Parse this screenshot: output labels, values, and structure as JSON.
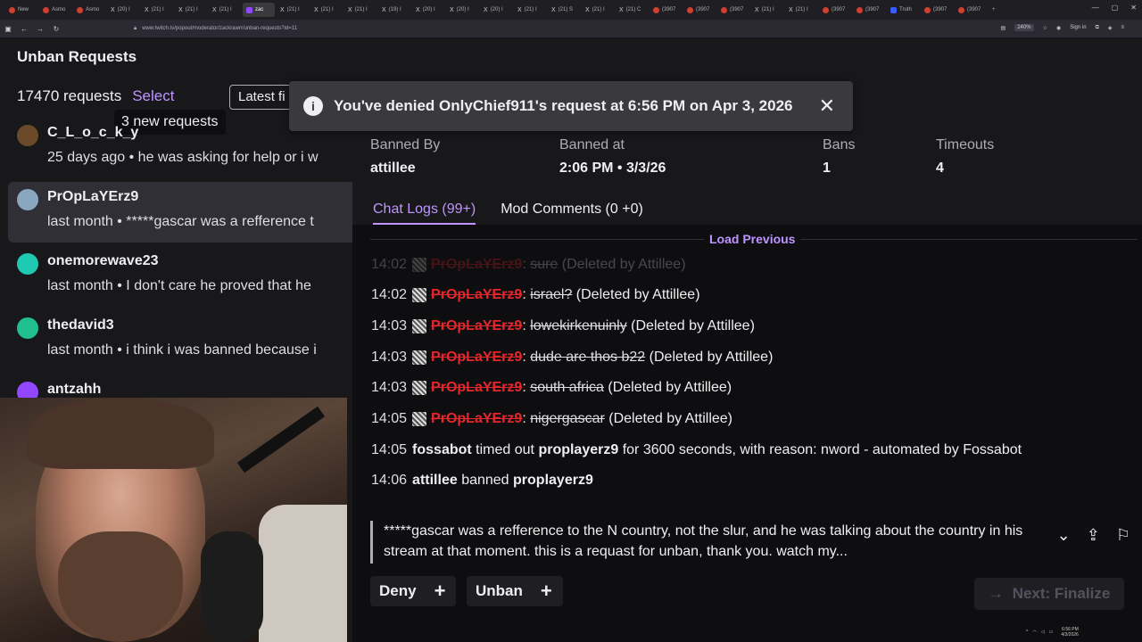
{
  "browser": {
    "tabs": [
      {
        "label": "New",
        "icon": "red"
      },
      {
        "label": "Asmo",
        "icon": "red"
      },
      {
        "label": "Asmo",
        "icon": "red"
      },
      {
        "label": "(20) I",
        "icon": "x"
      },
      {
        "label": "(21) I",
        "icon": "x"
      },
      {
        "label": "(21) I",
        "icon": "x"
      },
      {
        "label": "(21) I",
        "icon": "x"
      },
      {
        "label": "zac",
        "icon": "twitch",
        "active": true
      },
      {
        "label": "(21) I",
        "icon": "x"
      },
      {
        "label": "(21) I",
        "icon": "x"
      },
      {
        "label": "(21) I",
        "icon": "x"
      },
      {
        "label": "(19) I",
        "icon": "x"
      },
      {
        "label": "(20) I",
        "icon": "x"
      },
      {
        "label": "(20) I",
        "icon": "x"
      },
      {
        "label": "(20) I",
        "icon": "x"
      },
      {
        "label": "(21) I",
        "icon": "x"
      },
      {
        "label": "(21) S",
        "icon": "x"
      },
      {
        "label": "(21) I",
        "icon": "x"
      },
      {
        "label": "(21) C",
        "icon": "x"
      },
      {
        "label": "(3907",
        "icon": "red"
      },
      {
        "label": "(3907",
        "icon": "red"
      },
      {
        "label": "(3907",
        "icon": "red"
      },
      {
        "label": "(21) I",
        "icon": "x"
      },
      {
        "label": "(21) I",
        "icon": "x"
      },
      {
        "label": "(3907",
        "icon": "red"
      },
      {
        "label": "(3907",
        "icon": "red"
      },
      {
        "label": "Truth",
        "icon": "truth"
      },
      {
        "label": "(3907",
        "icon": "red"
      },
      {
        "label": "(3907",
        "icon": "red"
      }
    ],
    "url": "www.twitch.tv/popout/moderator/zackrawrr/unban-requests?id=11",
    "zoom": "240%",
    "sign_in": "Sign in"
  },
  "sidebar": {
    "title": "Unban Requests",
    "count": "17470 requests",
    "select": "Select",
    "filter": "Latest fi",
    "new_requests": "3 new requests",
    "requests": [
      {
        "name": "C_L_o_c_k_y",
        "meta": "25 days ago • he was asking for help or i w",
        "avatar_color": "#6b4a2a"
      },
      {
        "name": "PrOpLaYErz9",
        "meta": "last month • *****gascar was a refference t",
        "avatar_color": "#8aa7c0"
      },
      {
        "name": "onemorewave23",
        "meta": "last month • I don't care he proved that he",
        "avatar_color": "#1fc8b0"
      },
      {
        "name": "thedavid3",
        "meta": "last month • i think i was banned because i",
        "avatar_color": "#1fbf8f"
      },
      {
        "name": "antzahh",
        "meta": "",
        "avatar_color": "#9146ff"
      }
    ]
  },
  "toast": {
    "message": "You've denied OnlyChief911's request at 6:56 PM on Apr 3, 2026"
  },
  "details": {
    "banned_by_label": "Banned By",
    "banned_by": "attillee",
    "banned_at_label": "Banned at",
    "banned_at": "2:06 PM • 3/3/26",
    "bans_label": "Bans",
    "bans": "1",
    "timeouts_label": "Timeouts",
    "timeouts": "4"
  },
  "tabs": {
    "chat_logs": "Chat Logs (99+)",
    "mod_comments": "Mod Comments (0 +0)"
  },
  "load_previous": "Load Previous",
  "chat_log": [
    {
      "time": "14:02",
      "user": "PrOpLaYErz9",
      "msg": "sure",
      "note": "(Deleted by Attillee)",
      "faded": true
    },
    {
      "time": "14:02",
      "user": "PrOpLaYErz9",
      "msg": "israel?",
      "note": "(Deleted by Attillee)"
    },
    {
      "time": "14:03",
      "user": "PrOpLaYErz9",
      "msg": "lowekirkenuinly",
      "note": "(Deleted by Attillee)"
    },
    {
      "time": "14:03",
      "user": "PrOpLaYErz9",
      "msg": "dude are thos b22",
      "note": "(Deleted by Attillee)"
    },
    {
      "time": "14:03",
      "user": "PrOpLaYErz9",
      "msg": "south africa",
      "note": "(Deleted by Attillee)"
    },
    {
      "time": "14:05",
      "user": "PrOpLaYErz9",
      "msg": "nigergascar",
      "note": "(Deleted by Attillee)"
    }
  ],
  "system_log": [
    {
      "time": "14:05",
      "actor": "fossabot",
      "verb": "timed out",
      "target": "proplayerz9",
      "rest": "for 3600 seconds, with reason: nword - automated by Fossabot"
    },
    {
      "time": "14:06",
      "actor": "attillee",
      "verb": "banned",
      "target": "proplayerz9",
      "rest": ""
    }
  ],
  "reason": "*****gascar was a refference to the N country, not the slur, and he was talking about the country in his stream at that moment. this is a requast for unban, thank you. watch my...",
  "actions": {
    "deny": "Deny",
    "unban": "Unban",
    "next": "Next: Finalize"
  },
  "taskbar": {
    "time": "6:56 PM",
    "date": "4/3/2026"
  }
}
